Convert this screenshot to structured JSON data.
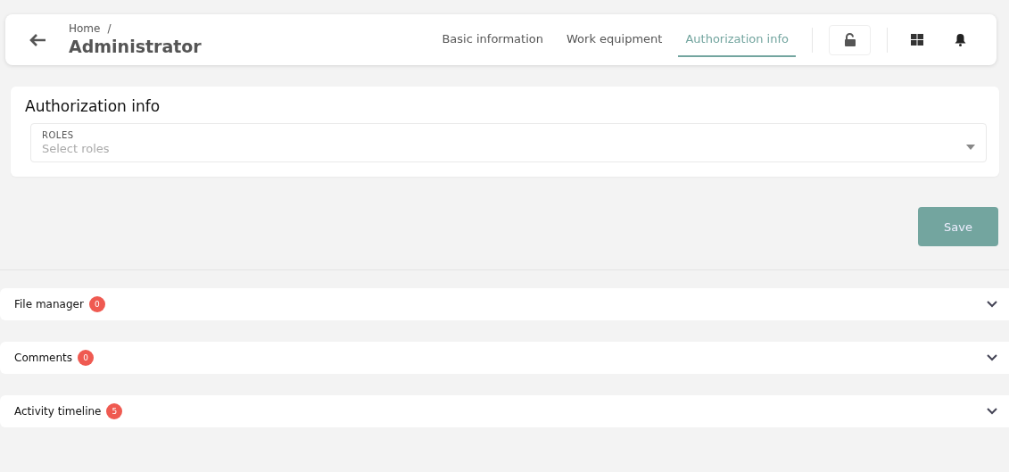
{
  "header": {
    "breadcrumb": "Home",
    "breadcrumb_separator": "/",
    "title": "Administrator",
    "tabs": [
      {
        "label": "Basic information",
        "selected": false
      },
      {
        "label": "Work equipment",
        "selected": false
      },
      {
        "label": "Authorization info",
        "selected": true
      }
    ]
  },
  "section": {
    "title": "Authorization info",
    "field": {
      "label": "ROLES",
      "placeholder": "Select roles"
    }
  },
  "save_button": "Save",
  "panels": [
    {
      "title": "File manager",
      "count": "0",
      "expanded": false
    },
    {
      "title": "Comments",
      "count": "0",
      "expanded": false
    },
    {
      "title": "Activity timeline",
      "count": "5",
      "expanded": false
    }
  ]
}
